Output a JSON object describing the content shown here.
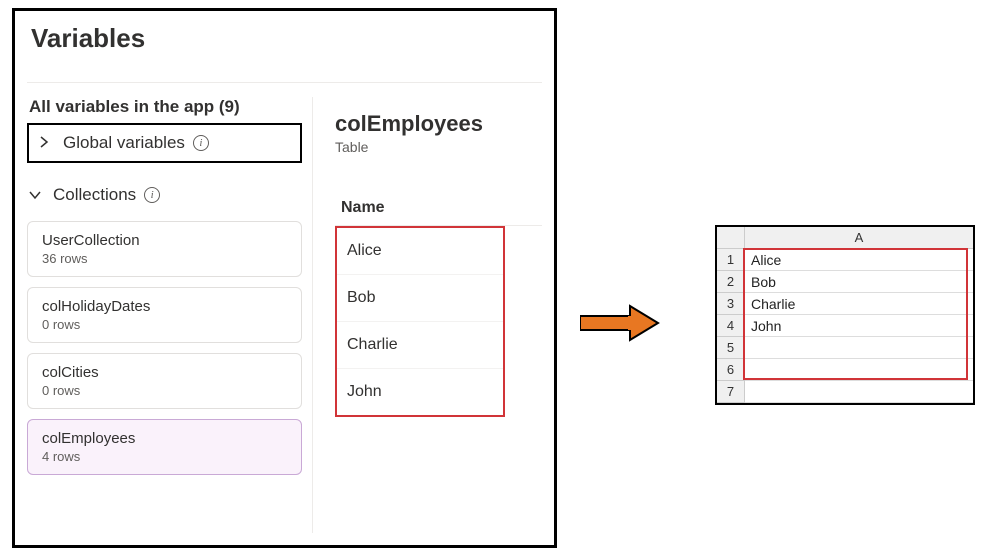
{
  "panel": {
    "title": "Variables",
    "section_header": "All variables in the app (9)",
    "global": {
      "label": "Global variables"
    },
    "collections_label": "Collections",
    "collections": [
      {
        "name": "UserCollection",
        "sub": "36 rows"
      },
      {
        "name": "colHolidayDates",
        "sub": "0 rows"
      },
      {
        "name": "colCities",
        "sub": "0 rows"
      },
      {
        "name": "colEmployees",
        "sub": "4 rows"
      }
    ]
  },
  "detail": {
    "title": "colEmployees",
    "type": "Table",
    "column": "Name",
    "rows": [
      "Alice",
      "Bob",
      "Charlie",
      "John"
    ]
  },
  "sheet": {
    "col": "A",
    "rows": [
      "Alice",
      "Bob",
      "Charlie",
      "John",
      "",
      "",
      ""
    ]
  }
}
